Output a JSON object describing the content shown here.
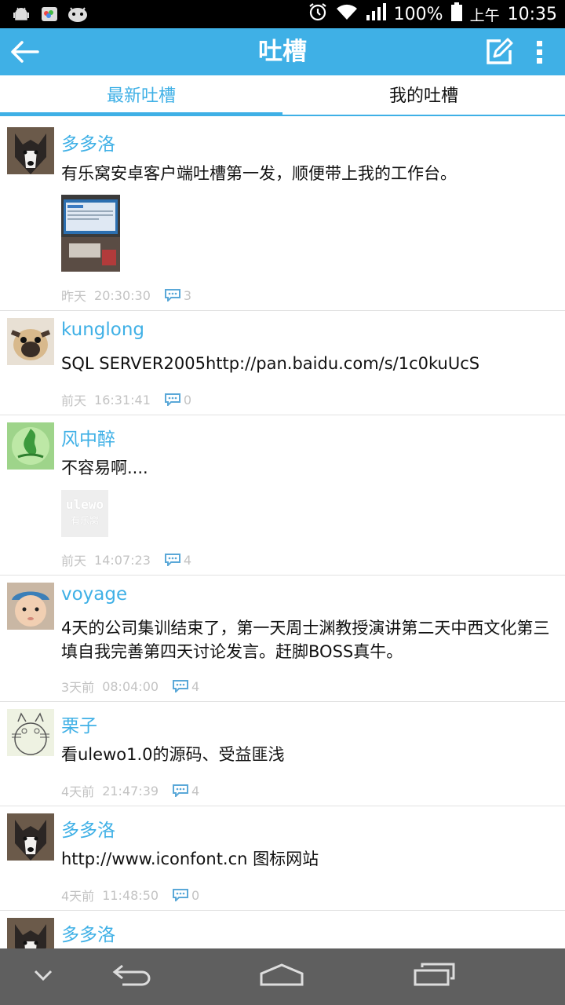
{
  "status_bar": {
    "battery": "100%",
    "ampm": "上午",
    "time": "10:35",
    "icons": [
      "android-icon",
      "photos-icon",
      "android-alt-icon",
      "alarm-icon",
      "wifi-icon",
      "signal-icon",
      "battery-icon"
    ]
  },
  "app_bar": {
    "title": "吐槽",
    "color": "#3fb0e6",
    "back_icon": "arrow-left-icon",
    "compose_icon": "compose-icon",
    "more_icon": "overflow-menu-icon"
  },
  "tabs": [
    {
      "label": "最新吐槽",
      "active": true
    },
    {
      "label": "我的吐槽",
      "active": false
    }
  ],
  "posts": [
    {
      "user": "多多洛",
      "text": "有乐窝安卓客户端吐槽第一发，顺便带上我的工作台。",
      "day": "昨天",
      "time": "20:30:30",
      "comments": "3",
      "image": "workstation-photo"
    },
    {
      "user": "kunglong",
      "text": "SQL SERVER2005http://pan.baidu.com/s/1c0kuUcS",
      "day": "前天",
      "time": "16:31:41",
      "comments": "0"
    },
    {
      "user": "风中醉",
      "text": "不容易啊....",
      "day": "前天",
      "time": "14:07:23",
      "comments": "4",
      "image": "ulewo-placeholder",
      "image_text_1": "ulewo",
      "image_text_2": "有乐窝"
    },
    {
      "user": "voyage",
      "text": "4天的公司集训结束了，第一天周士渊教授演讲第二天中西文化第三填自我完善第四天讨论发言。赶脚BOSS真牛。",
      "day": "3天前",
      "time": "08:04:00",
      "comments": "4"
    },
    {
      "user": "栗子",
      "text": "看ulewo1.0的源码、受益匪浅",
      "day": "4天前",
      "time": "21:47:39",
      "comments": "4"
    },
    {
      "user": "多多洛",
      "text": "http://www.iconfont.cn 图标网站",
      "day": "4天前",
      "time": "11:48:50",
      "comments": "0"
    },
    {
      "user": "多多洛"
    }
  ],
  "nav_bar": {
    "icons": [
      "hide-keyboard-icon",
      "back-nav-icon",
      "home-nav-icon",
      "recents-nav-icon"
    ]
  }
}
